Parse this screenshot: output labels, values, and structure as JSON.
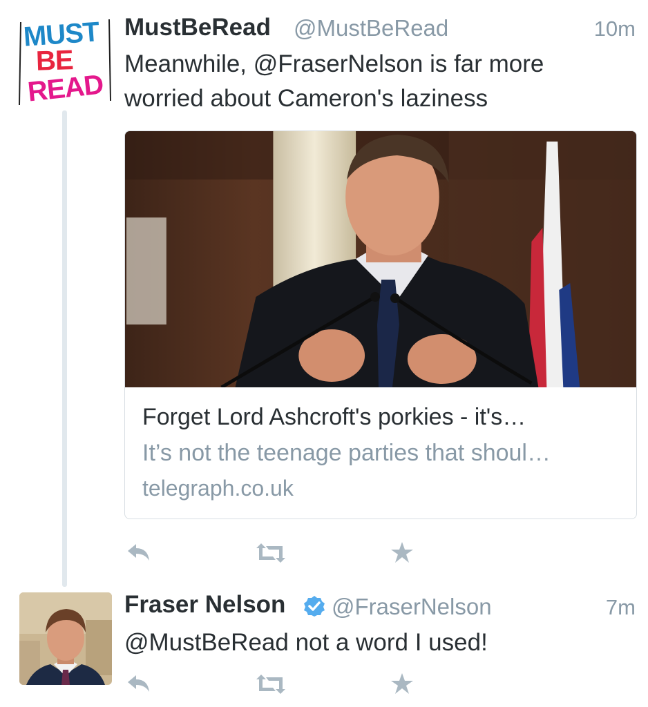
{
  "tweets": [
    {
      "avatar_text": [
        "MUST",
        "BE",
        "READ"
      ],
      "name": "MustBeRead",
      "handle": "@MustBeRead",
      "time": "10m",
      "text_line1": "Meanwhile, @FraserNelson is far more",
      "text_line2": "worried about Cameron's laziness",
      "card": {
        "title": "Forget Lord Ashcroft's porkies - it's…",
        "description": "It’s not the teenage parties that shoul…",
        "domain": "telegraph.co.uk"
      },
      "actions": [
        "reply-icon",
        "retweet-icon",
        "favorite-icon"
      ]
    },
    {
      "name": "Fraser Nelson",
      "verified": true,
      "handle": "@FraserNelson",
      "time": "7m",
      "text": "@MustBeRead not a word I used!",
      "actions": [
        "reply-icon",
        "retweet-icon",
        "favorite-icon"
      ]
    }
  ],
  "colors": {
    "logo_blue": "#1e88c8",
    "logo_red": "#e8253f",
    "logo_pink": "#e4188c",
    "verified_blue": "#55acee",
    "muted": "#8899a6",
    "icon": "#aab8c2"
  }
}
